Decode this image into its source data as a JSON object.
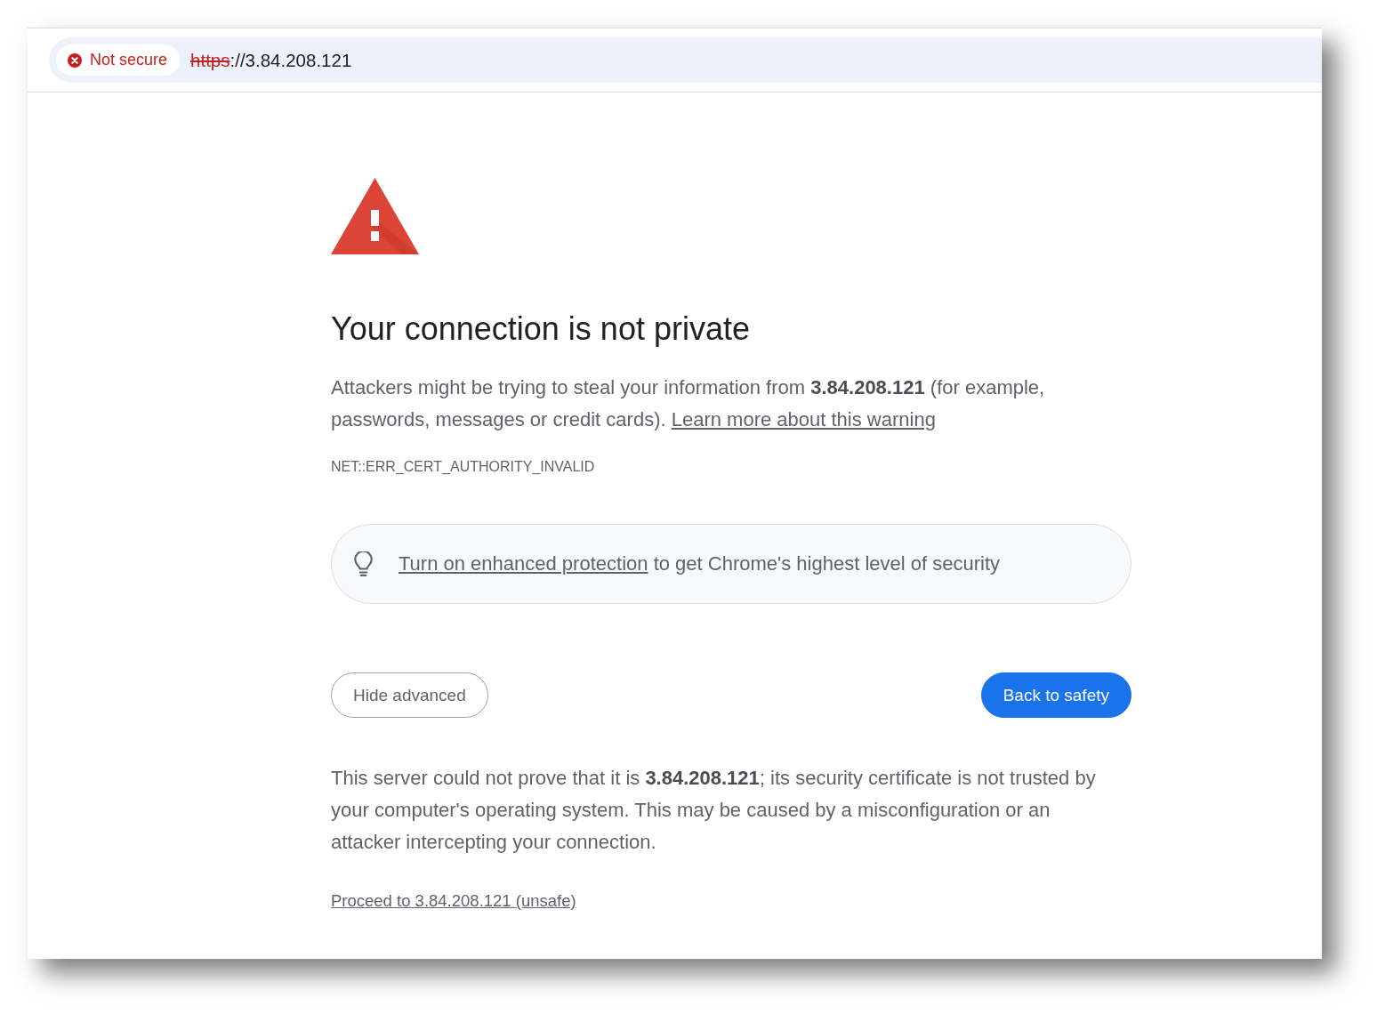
{
  "address_bar": {
    "secure": false,
    "security_chip": "Not secure",
    "url_scheme": "https",
    "url_rest": "://3.84.208.121"
  },
  "interstitial": {
    "heading": "Your connection is not private",
    "message": "Attackers might be trying to steal your information from **3.84.208.121** (for example, passwords, messages or credit cards).",
    "learn_more_link": "Learn more about this warning",
    "error_code": "NET::ERR_CERT_AUTHORITY_INVALID",
    "tip": {
      "link": "Turn on enhanced protection",
      "text": "to get Chrome's highest level of security"
    },
    "buttons": [
      {
        "label": "Hide advanced",
        "kind": "secondary"
      },
      {
        "label": "Back to safety",
        "kind": "primary"
      }
    ],
    "details": "This server could not prove that it is **3.84.208.121**; its security certificate is not trusted by your computer's operating system. This may be caused by a misconfiguration or an attacker intercepting your connection.",
    "proceed_link": "Proceed to 3.84.208.121 (unsafe)"
  }
}
